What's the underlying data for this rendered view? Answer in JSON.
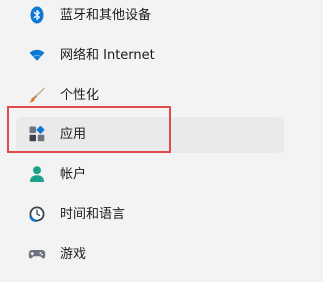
{
  "nav": {
    "items": [
      {
        "label": "蓝牙和其他设备",
        "icon": "bluetooth-icon"
      },
      {
        "label": "网络和 Internet",
        "icon": "wifi-icon"
      },
      {
        "label": "个性化",
        "icon": "brush-icon"
      },
      {
        "label": "应用",
        "icon": "apps-icon",
        "selected": true
      },
      {
        "label": "帐户",
        "icon": "account-icon"
      },
      {
        "label": "时间和语言",
        "icon": "clock-globe-icon"
      },
      {
        "label": "游戏",
        "icon": "gamepad-icon"
      }
    ]
  },
  "colors": {
    "background": "#f3f3f3",
    "selected_background": "#eaeaea",
    "accent_blue": "#0a78d4",
    "account_teal": "#1aa38a",
    "highlight_red": "#e04a4a"
  }
}
